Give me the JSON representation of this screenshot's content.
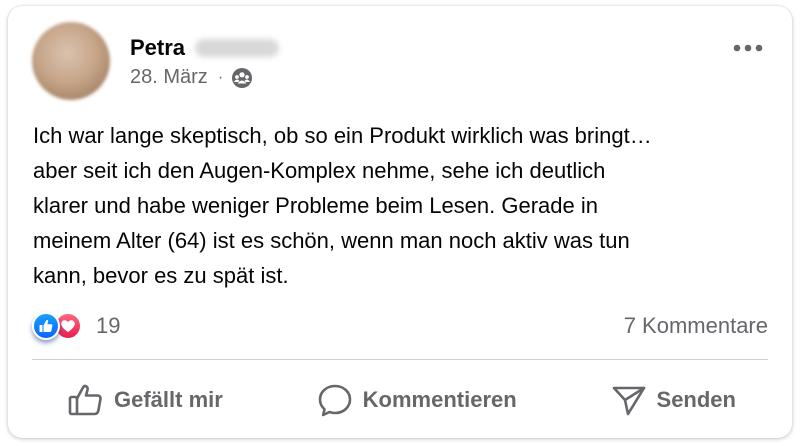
{
  "post": {
    "author_first_name": "Petra",
    "date": "28. März",
    "meta_separator": "·",
    "audience_icon": "friends-icon",
    "more_icon": "more-horizontal-icon",
    "text": "Ich war lange skeptisch, ob so ein Produkt wirklich was bringt…\naber seit ich den Augen-Komplex nehme, sehe ich deutlich\nklarer und habe weniger Probleme beim Lesen. Gerade in\nmeinem Alter (64) ist es schön, wenn man noch aktiv was tun\nkann, bevor es zu spät ist."
  },
  "reactions": {
    "icons": [
      "like-reaction-icon",
      "love-reaction-icon"
    ],
    "count": "19",
    "comments_label": "7 Kommentare"
  },
  "actions": {
    "like_label": "Gefällt mir",
    "comment_label": "Kommentieren",
    "send_label": "Senden"
  },
  "colors": {
    "secondary_text": "#65676b",
    "like_blue": "#0866ff",
    "love_red": "#e61e4d",
    "divider": "#ced0d4"
  }
}
